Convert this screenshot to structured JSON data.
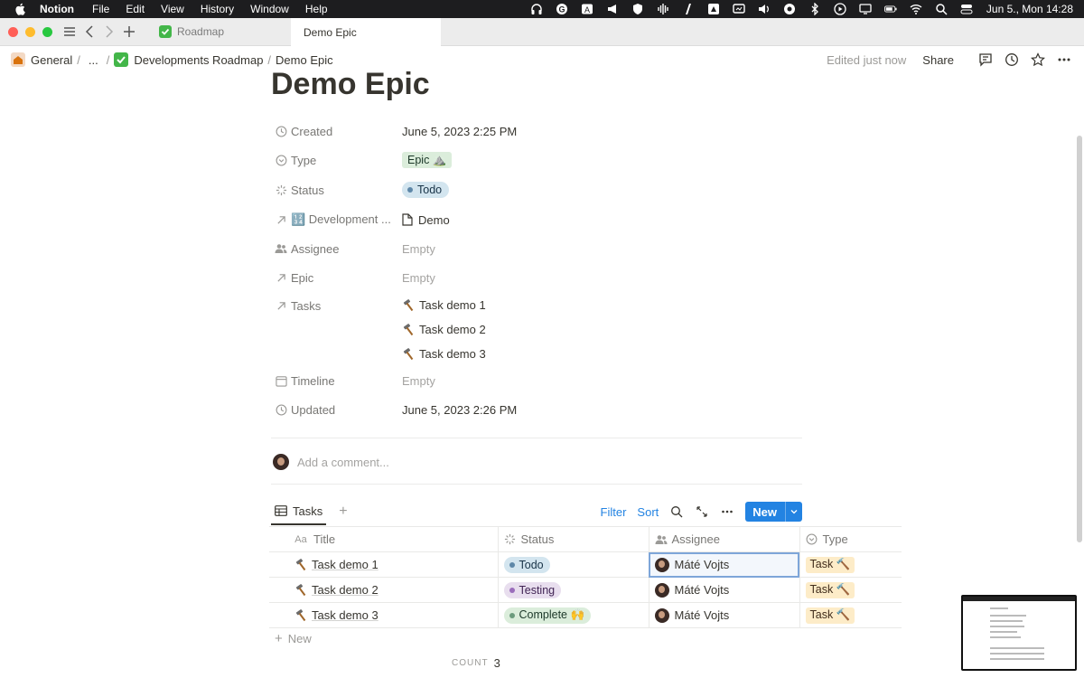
{
  "menubar": {
    "app_name": "Notion",
    "menus": [
      "File",
      "Edit",
      "View",
      "History",
      "Window",
      "Help"
    ],
    "clock": "Jun 5., Mon  14:28"
  },
  "tabs": [
    {
      "label": "Roadmap",
      "icon": "check-box-icon",
      "active": false
    },
    {
      "label": "Demo Epic",
      "active": true
    }
  ],
  "breadcrumb": {
    "items": [
      "General",
      "...",
      "Developments Roadmap",
      "Demo Epic"
    ]
  },
  "topbar": {
    "edited": "Edited just now",
    "share": "Share"
  },
  "page": {
    "title": "Demo Epic",
    "properties": {
      "created": {
        "label": "Created",
        "value": "June 5, 2023 2:25 PM"
      },
      "type": {
        "label": "Type",
        "value": "Epic ⛰️"
      },
      "status": {
        "label": "Status",
        "value": "Todo"
      },
      "development": {
        "label": "🔢 Development ...",
        "value": "Demo"
      },
      "assignee": {
        "label": "Assignee",
        "value": "Empty"
      },
      "epic": {
        "label": "Epic",
        "value": "Empty"
      },
      "tasks": {
        "label": "Tasks",
        "values": [
          "Task demo 1",
          "Task demo 2",
          "Task demo 3"
        ]
      },
      "timeline": {
        "label": "Timeline",
        "value": "Empty"
      },
      "updated": {
        "label": "Updated",
        "value": "June 5, 2023 2:26 PM"
      }
    },
    "comment_placeholder": "Add a comment..."
  },
  "database": {
    "view_tab": "Tasks",
    "filter": "Filter",
    "sort": "Sort",
    "new_button": "New",
    "columns": [
      "Title",
      "Status",
      "Assignee",
      "Type"
    ],
    "rows": [
      {
        "title": "Task demo 1",
        "status": "Todo",
        "assignee": "Máté Vojts",
        "type": "Task 🔨"
      },
      {
        "title": "Task demo 2",
        "status": "Testing",
        "assignee": "Máté Vojts",
        "type": "Task 🔨"
      },
      {
        "title": "Task demo 3",
        "status": "Complete 🙌",
        "assignee": "Máté Vojts",
        "type": "Task 🔨"
      }
    ],
    "new_row": "New",
    "count_label": "COUNT",
    "count_value": "3"
  },
  "colors": {
    "accent": "#2383e2",
    "status_todo": "#d3e5ef",
    "status_testing": "#e8deee",
    "status_complete": "#dbeddb",
    "type_task": "#fdecc8"
  }
}
